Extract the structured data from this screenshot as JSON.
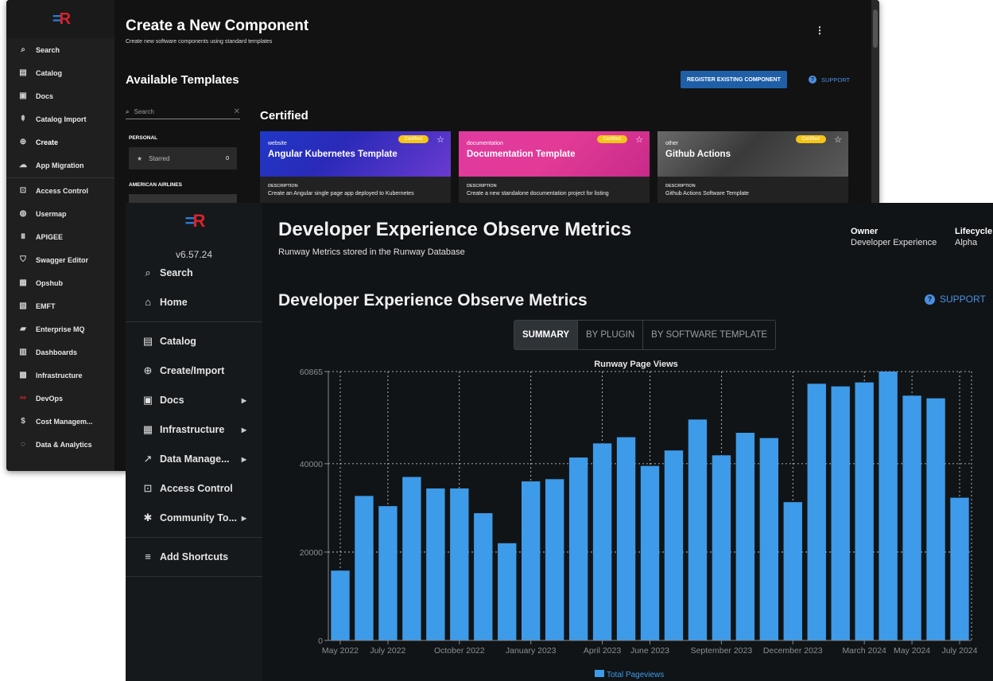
{
  "back_window": {
    "sidebar": {
      "items": [
        {
          "icon": "search-icon",
          "label": "Search"
        },
        {
          "icon": "catalog-icon",
          "label": "Catalog"
        },
        {
          "icon": "docs-icon",
          "label": "Docs"
        },
        {
          "icon": "import-icon",
          "label": "Catalog Import"
        },
        {
          "icon": "create-icon",
          "label": "Create"
        },
        {
          "icon": "cloud-icon",
          "label": "App Migration"
        },
        {
          "icon": "lock-icon",
          "label": "Access Control"
        },
        {
          "icon": "map-icon",
          "label": "Usermap"
        },
        {
          "icon": "apigee-icon",
          "label": "APIGEE"
        },
        {
          "icon": "shield-icon",
          "label": "Swagger Editor"
        },
        {
          "icon": "grid-icon",
          "label": "Opshub"
        },
        {
          "icon": "file-icon",
          "label": "EMFT"
        },
        {
          "icon": "mq-icon",
          "label": "Enterprise MQ"
        },
        {
          "icon": "bar-chart-icon",
          "label": "Dashboards"
        },
        {
          "icon": "building-icon",
          "label": "Infrastructure"
        },
        {
          "icon": "devops-icon",
          "label": "DevOps"
        },
        {
          "icon": "dollar-icon",
          "label": "Cost Managem..."
        },
        {
          "icon": "analytics-icon",
          "label": "Data & Analytics"
        }
      ]
    },
    "header": {
      "title": "Create a New Component",
      "subtitle": "Create new software components using standard templates"
    },
    "available_templates": "Available Templates",
    "register_button": "REGISTER EXISTING COMPONENT",
    "support_label": "SUPPORT",
    "search_placeholder": "Search",
    "personal_label": "PERSONAL",
    "starred_label": "Starred",
    "starred_count": "0",
    "american_airlines_label": "AMERICAN AIRLINES",
    "certified_label": "Certified",
    "cards": [
      {
        "type": "website",
        "name": "Angular Kubernetes Template",
        "badge": "Certified",
        "desc_label": "DESCRIPTION",
        "desc": "Create an Angular single page app deployed to Kubernetes",
        "color": "#2038c8"
      },
      {
        "type": "documentation",
        "name": "Documentation Template",
        "badge": "Certified",
        "desc_label": "DESCRIPTION",
        "desc": "Create a new standalone documentation project for listing",
        "color": "#e03aa0"
      },
      {
        "type": "other",
        "name": "Github Actions",
        "badge": "Certified",
        "desc_label": "DESCRIPTION",
        "desc": "Github Actions Software Template",
        "color": "#5a5a5a"
      }
    ]
  },
  "front_window": {
    "sidebar": {
      "version": "v6.57.24",
      "items": [
        {
          "icon": "search-icon",
          "label": "Search"
        },
        {
          "icon": "home-icon",
          "label": "Home"
        },
        {
          "icon": "catalog-icon",
          "label": "Catalog"
        },
        {
          "icon": "create-icon",
          "label": "Create/Import"
        },
        {
          "icon": "docs-icon",
          "label": "Docs"
        },
        {
          "icon": "building-icon",
          "label": "Infrastructure"
        },
        {
          "icon": "trend-icon",
          "label": "Data Manage..."
        },
        {
          "icon": "lock-icon",
          "label": "Access Control"
        },
        {
          "icon": "community-icon",
          "label": "Community To..."
        },
        {
          "icon": "add-shortcut-icon",
          "label": "Add Shortcuts"
        }
      ]
    },
    "header": {
      "title": "Developer Experience Observe Metrics",
      "subtitle": "Runway Metrics stored in the Runway Database",
      "owner_label": "Owner",
      "owner_value": "Developer Experience",
      "lifecycle_label": "Lifecycle",
      "lifecycle_value": "Alpha"
    },
    "section_title": "Developer Experience Observe Metrics",
    "support_label": "SUPPORT",
    "tabs": [
      "SUMMARY",
      "BY PLUGIN",
      "BY SOFTWARE TEMPLATE"
    ],
    "active_tab": "SUMMARY"
  },
  "colors": {
    "accent": "#4a90e2",
    "bar": "#3d9be9",
    "badge": "#f5c518",
    "register_button": "#1f5fa8"
  },
  "chart_data": {
    "type": "bar",
    "title": "Runway Page Views",
    "legend": "Total Pageviews",
    "legend_position": "bottom",
    "grid": true,
    "ylim": [
      0,
      60865
    ],
    "y_ticks": [
      0,
      20000,
      40000,
      60865
    ],
    "x_tick_labels": [
      "May 2022",
      "July 2022",
      "October 2022",
      "January 2023",
      "April 2023",
      "June 2023",
      "September 2023",
      "December 2023",
      "March 2024",
      "May 2024",
      "July 2024"
    ],
    "categories": [
      "May 2022",
      "June 2022",
      "July 2022",
      "August 2022",
      "September 2022",
      "October 2022",
      "November 2022",
      "December 2022",
      "January 2023",
      "February 2023",
      "March 2023",
      "April 2023",
      "May 2023",
      "June 2023",
      "July 2023",
      "August 2023",
      "September 2023",
      "October 2023",
      "November 2023",
      "December 2023",
      "January 2024",
      "February 2024",
      "March 2024",
      "April 2024",
      "May 2024",
      "June 2024",
      "July 2024"
    ],
    "series": [
      {
        "name": "Total Pageviews",
        "values": [
          15800,
          32700,
          30400,
          37000,
          34400,
          34400,
          28800,
          22000,
          36000,
          36500,
          41400,
          44600,
          46000,
          39500,
          43000,
          50000,
          41900,
          47000,
          45800,
          31300,
          58100,
          57500,
          58400,
          60865,
          55400,
          54800,
          32300
        ]
      }
    ]
  }
}
